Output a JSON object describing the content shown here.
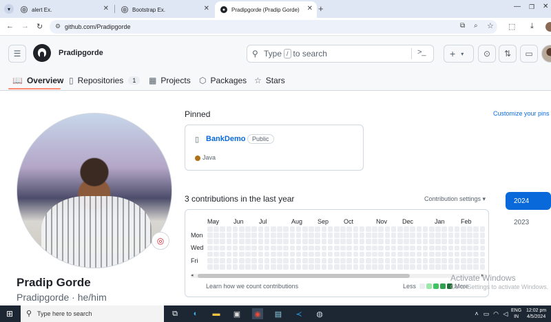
{
  "browser": {
    "tabs": [
      {
        "title": "alert Ex."
      },
      {
        "title": "Bootstrap Ex."
      },
      {
        "title": "Pradipgorde (Pradip Gorde)"
      }
    ],
    "url": "github.com/Pradipgorde"
  },
  "header": {
    "username": "Pradipgorde",
    "search_pre": "Type",
    "search_key": "/",
    "search_post": "to search",
    "plus_label": "+"
  },
  "nav": {
    "tabs": [
      {
        "label": "Overview"
      },
      {
        "label": "Repositories",
        "count": "1"
      },
      {
        "label": "Projects"
      },
      {
        "label": "Packages"
      },
      {
        "label": "Stars"
      }
    ]
  },
  "profile": {
    "full_name": "Pradip Gorde",
    "login_line": "Pradipgorde · he/him"
  },
  "pinned": {
    "title": "Pinned",
    "customize": "Customize your pins",
    "repo": {
      "name": "BankDemo",
      "visibility": "Public",
      "language": "Java"
    }
  },
  "contributions": {
    "title": "3 contributions in the last year",
    "settings": "Contribution settings ▾",
    "months": [
      "May",
      "Jun",
      "Jul",
      "Aug",
      "Sep",
      "Oct",
      "Nov",
      "Dec",
      "Jan",
      "Feb"
    ],
    "days": [
      "Mon",
      "Wed",
      "Fri"
    ],
    "learn": "Learn how we count contributions",
    "legend_less": "Less",
    "legend_more": "More",
    "levels": [
      "#ebedf0",
      "#9be9a8",
      "#40c463",
      "#30a14e",
      "#216e39"
    ]
  },
  "years": [
    "2024",
    "2023"
  ],
  "watermark": {
    "line1": "Activate Windows",
    "line2": "Go to Settings to activate Windows."
  },
  "taskbar": {
    "search_placeholder": "Type here to search",
    "lang": "ENG",
    "region": "IN",
    "time": "12:02 pm",
    "date": "4/5/2024"
  }
}
